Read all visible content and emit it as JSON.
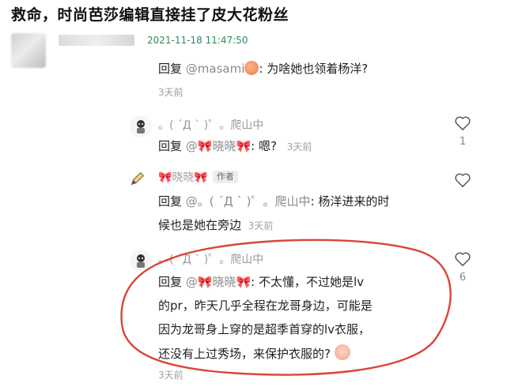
{
  "title": "救命，时尚芭莎编辑直接挂了皮大花粉丝",
  "top_comment": {
    "timestamp": "2021-11-18 11:47:50",
    "reply_prefix": "回复",
    "mention": "@masami",
    "text": ": 为啥她也领着杨洋?",
    "time_ago": "3天前"
  },
  "comment1": {
    "username": "。(  ´Д ` )゜。爬山中",
    "reply_prefix": "回复",
    "mention": "@🎀晓晓🎀",
    "text": ": 嗯?",
    "time_ago": "3天前",
    "likes": "1"
  },
  "comment2": {
    "username": "🎀晓晓🎀",
    "author_badge": "作者",
    "reply_prefix": "回复",
    "mention": "@。(  ´Д ` )゜。爬山中",
    "text_line1": ": 杨洋进来的时",
    "text_line2": "候也是她在旁边",
    "time_ago": "3天前"
  },
  "comment3": {
    "username": "。(  ´Д ` )゜。爬山中",
    "reply_prefix": "回复",
    "mention": "@🎀晓晓🎀",
    "text_line1": ": 不太懂，不过她是lv",
    "text_line2": "的pr，昨天几乎全程在龙哥身边，可能是",
    "text_line3": "因为龙哥身上穿的是超季首穿的lv衣服，",
    "text_line4": "还没有上过秀场，来保护衣服的?",
    "time_ago": "3天前",
    "likes": "6"
  },
  "icons": {
    "like": "heart-outline-icon",
    "emoji_peach": "peach-emoji",
    "emoji_cry": "crying-face-emoji"
  },
  "colors": {
    "timestamp": "#2e8b57",
    "annotation_circle": "#d9453a"
  }
}
